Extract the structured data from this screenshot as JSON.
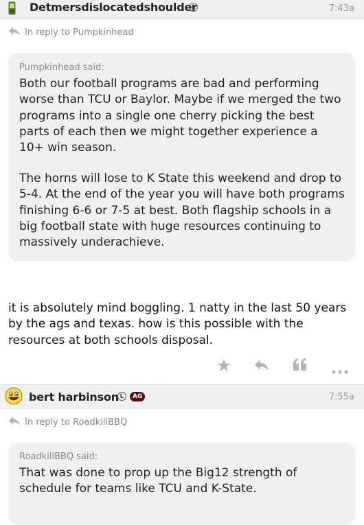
{
  "post1": {
    "username": "Detmersdislocatedshoulder",
    "badge": "L",
    "time": "7:43a",
    "reply_to": "In reply to Pumpkinhead",
    "quote_author": "Pumpkinhead said:",
    "quote_para1": "Both our football programs are bad and performing worse than TCU or Baylor. Maybe if we merged the two programs into a single one cherry picking the best parts of each then we might together experience a 10+ win season.",
    "quote_para2": "The horns will lose to K State this weekend and drop to 5-4. At the end of the year you will have both programs finishing 6-6 or 7-5 at best. Both flagship schools in a big football state with huge resources continuing to massively underachieve.",
    "body": "it is absolutely mind boggling. 1 natty in the last 50 years by the ags and texas. how is this possible with the resources at both schools disposal."
  },
  "post2": {
    "username": "bert harbinson",
    "badge": "L",
    "badge_ag": "AG",
    "time": "7:55a",
    "reply_to": "In reply to RoadkillBBQ",
    "quote_author": "RoadkillBBQ said:",
    "quote_para1": "That was done to prop up the Big12 strength of schedule for teams like TCU and K-State."
  },
  "icons": [
    "phone-icon",
    "reply-arrow-icon",
    "star-icon",
    "reply-icon",
    "quote-icon",
    "more-icon",
    "smiley-avatar-icon"
  ],
  "colors": {
    "header_bg": "#f0f0f0",
    "quote_bg": "#f0f0f0",
    "ag_badge": "#5a0e0e",
    "muted": "#888888",
    "icon": "#b5b5b5"
  }
}
